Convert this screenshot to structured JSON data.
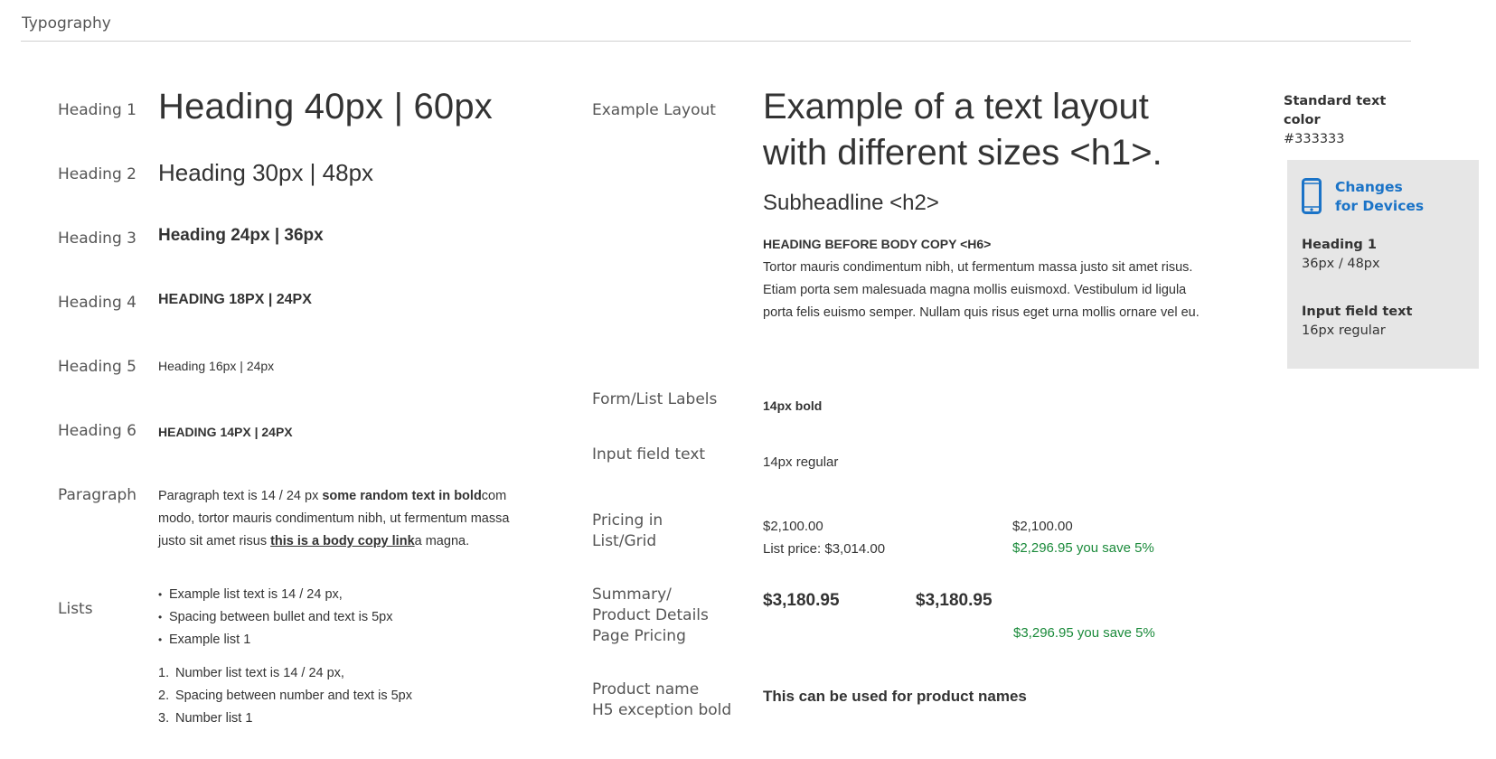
{
  "page": {
    "title": "Typography"
  },
  "left": {
    "rows": [
      {
        "label": "Heading 1",
        "sample": "Heading 40px | 60px"
      },
      {
        "label": "Heading 2",
        "sample": "Heading 30px | 48px"
      },
      {
        "label": "Heading 3",
        "sample": "Heading 24px | 36px"
      },
      {
        "label": "Heading 4",
        "sample": "Heading 18px | 24px"
      },
      {
        "label": "Heading 5",
        "sample": "Heading 16px | 24px"
      },
      {
        "label": "Heading 6",
        "sample": "Heading 14px | 24px"
      }
    ],
    "paragraph": {
      "label": "Paragraph",
      "text_1": "Paragraph text is 14 / 24 px ",
      "bold": "some random text in bold",
      "text_2": "com modo, tortor mauris condimentum nibh, ut fermentum massa justo sit amet risus ",
      "link": "this is a body copy link",
      "text_3": "a magna."
    },
    "lists": {
      "label": "Lists",
      "bullets": [
        "Example list text is 14 / 24 px,",
        "Spacing between bullet and text is 5px",
        "Example list 1"
      ],
      "numbers": [
        {
          "n": "1.",
          "text": "Number list text is 14 / 24 px,"
        },
        {
          "n": "2.",
          "text": "Spacing between number and text is 5px"
        },
        {
          "n": "3.",
          "text": "Number list 1"
        }
      ]
    }
  },
  "middle": {
    "example_layout": {
      "label": "Example Layout",
      "h1": "Example of a text layout with different sizes <h1>.",
      "h2": "Subheadline <h2>",
      "h6": "Heading before body copy  <h6>",
      "body": "Tortor mauris condimentum nibh, ut fermentum massa justo sit amet risus. Etiam porta sem malesuada magna mollis euismoxd. Vestibulum id ligula porta felis euismo  semper. Nullam quis risus eget urna mollis ornare vel eu."
    },
    "form_labels": {
      "label": "Form/List Labels",
      "value": "14px bold"
    },
    "input_text": {
      "label": "Input field text",
      "value": "14px regular"
    },
    "pricing_list": {
      "label_1": "Pricing in",
      "label_2": "List/Grid",
      "a_price": "$2,100.00",
      "a_list": "List price: $3,014.00",
      "b_price": "$2,100.00",
      "b_save": "$2,296.95 you save 5%"
    },
    "pricing_summary": {
      "label_1": "Summary/",
      "label_2": "Product Details",
      "label_3": "Page Pricing",
      "a_price": "$3,180.95",
      "b_price": "$3,180.95",
      "b_save": "$3,296.95 you save 5%"
    },
    "product_name": {
      "label_1": "Product name",
      "label_2": "H5 exception bold",
      "value": "This can be used for product names"
    }
  },
  "right": {
    "std_color_title_1": "Standard text",
    "std_color_title_2": "color",
    "std_color_value": "#333333",
    "devices": {
      "title_1": "Changes",
      "title_2": "for Devices",
      "icon": "smartphone-icon",
      "h1_label": "Heading 1",
      "h1_value": "36px / 48px",
      "input_label": "Input field text",
      "input_value": "16px regular"
    }
  },
  "colors": {
    "text": "#333333",
    "accent_blue": "#1a73c7",
    "savings_green": "#1a8a3a",
    "panel": "#e6e6e6"
  }
}
